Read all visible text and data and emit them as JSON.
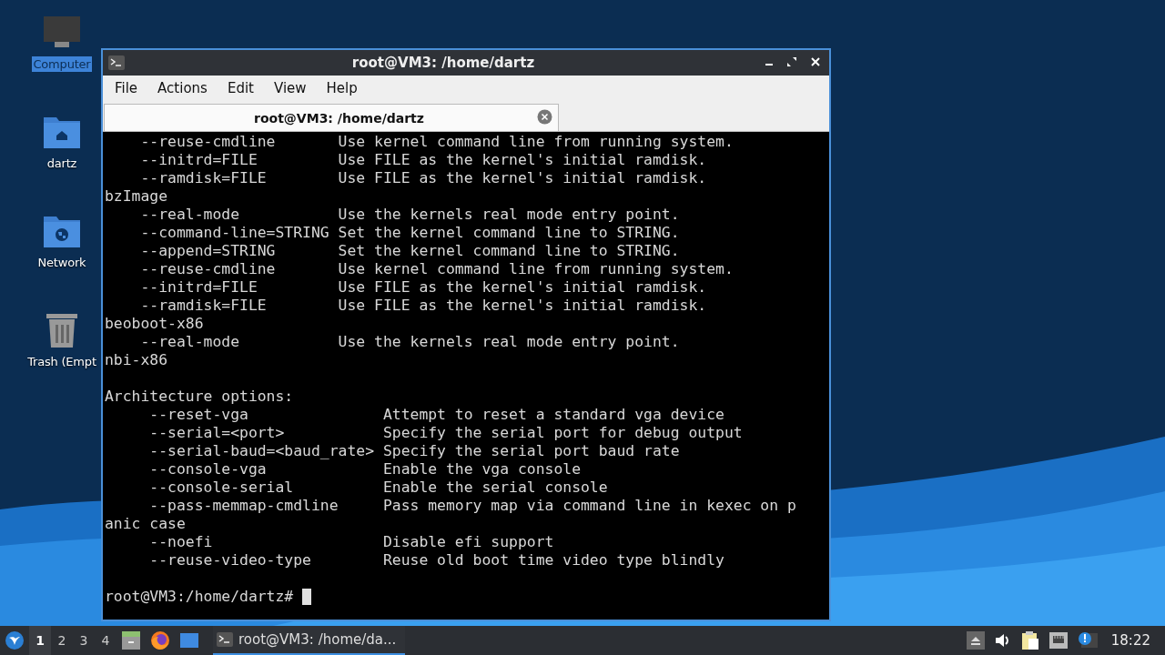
{
  "desktop_icons": [
    {
      "label": "Computer",
      "kind": "monitor",
      "selected": true
    },
    {
      "label": "dartz",
      "kind": "home-folder",
      "selected": false
    },
    {
      "label": "Network",
      "kind": "network-folder",
      "selected": false
    },
    {
      "label": "Trash (Empt",
      "kind": "trash",
      "selected": false
    }
  ],
  "window": {
    "title": "root@VM3: /home/dartz",
    "menu": [
      "File",
      "Actions",
      "Edit",
      "View",
      "Help"
    ],
    "tabs": [
      {
        "label": "root@VM3: /home/dartz",
        "selected": true
      }
    ],
    "terminal": {
      "blocks": [
        [
          "    --reuse-cmdline       Use kernel command line from running system.",
          "    --initrd=FILE         Use FILE as the kernel's initial ramdisk.",
          "    --ramdisk=FILE        Use FILE as the kernel's initial ramdisk.",
          "bzImage",
          "    --real-mode           Use the kernels real mode entry point.",
          "    --command-line=STRING Set the kernel command line to STRING.",
          "    --append=STRING       Set the kernel command line to STRING.",
          "    --reuse-cmdline       Use kernel command line from running system.",
          "    --initrd=FILE         Use FILE as the kernel's initial ramdisk.",
          "    --ramdisk=FILE        Use FILE as the kernel's initial ramdisk.",
          "beoboot-x86",
          "    --real-mode           Use the kernels real mode entry point.",
          "nbi-x86"
        ],
        [
          "Architecture options:",
          "     --reset-vga               Attempt to reset a standard vga device",
          "     --serial=<port>           Specify the serial port for debug output",
          "     --serial-baud=<baud_rate> Specify the serial port baud rate",
          "     --console-vga             Enable the vga console",
          "     --console-serial          Enable the serial console",
          "     --pass-memmap-cmdline     Pass memory map via command line in kexec on p",
          "anic case",
          "     --noefi                   Disable efi support",
          "     --reuse-video-type        Reuse old boot time video type blindly"
        ]
      ],
      "prompt": "root@VM3:/home/dartz#"
    }
  },
  "taskbar": {
    "workspaces": [
      {
        "label": "1",
        "selected": true
      },
      {
        "label": "2",
        "selected": false
      },
      {
        "label": "3",
        "selected": false
      },
      {
        "label": "4",
        "selected": false
      }
    ],
    "tasks": [
      {
        "label": "root@VM3: /home/da...",
        "selected": true
      }
    ],
    "clock": "18:22"
  }
}
